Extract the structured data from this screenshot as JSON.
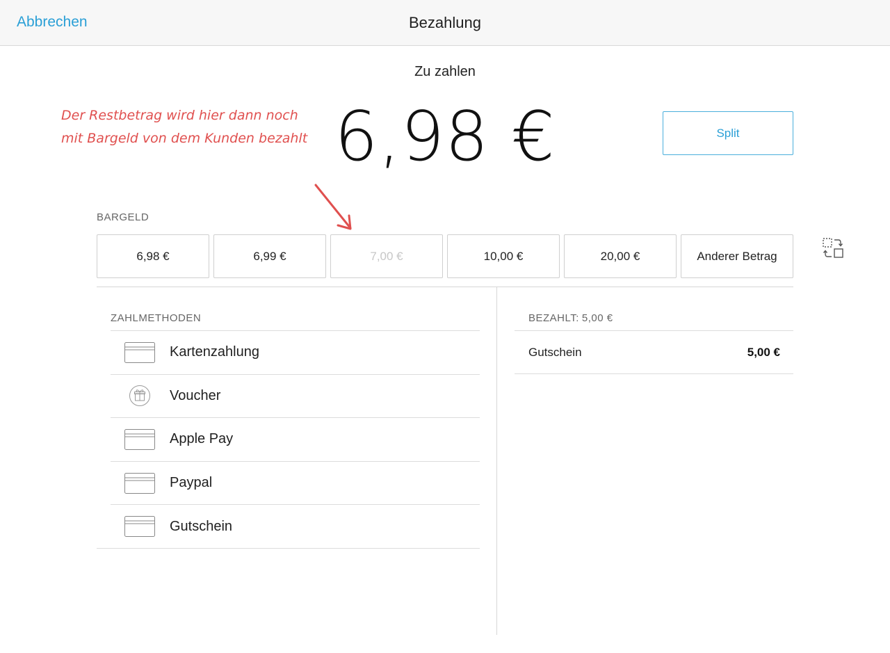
{
  "navbar": {
    "cancel_label": "Abbrechen",
    "title": "Bezahlung"
  },
  "due": {
    "label": "Zu zahlen",
    "amount": "6,98 €"
  },
  "annotation": {
    "line1": "Der Restbetrag wird hier dann noch",
    "line2": "mit Bargeld von dem Kunden bezahlt",
    "color": "#e0504f"
  },
  "split_label": "Split",
  "cash": {
    "label": "BARGELD",
    "options": [
      {
        "label": "6,98 €",
        "enabled": true
      },
      {
        "label": "6,99 €",
        "enabled": true
      },
      {
        "label": "7,00 €",
        "enabled": false
      },
      {
        "label": "10,00 €",
        "enabled": true
      },
      {
        "label": "20,00 €",
        "enabled": true
      },
      {
        "label": "Anderer Betrag",
        "enabled": true
      }
    ]
  },
  "methods": {
    "label": "ZAHLMETHODEN",
    "items": [
      {
        "label": "Kartenzahlung",
        "icon": "credit-card-icon"
      },
      {
        "label": "Voucher",
        "icon": "gift-icon"
      },
      {
        "label": "Apple Pay",
        "icon": "credit-card-icon"
      },
      {
        "label": "Paypal",
        "icon": "credit-card-icon"
      },
      {
        "label": "Gutschein",
        "icon": "credit-card-icon"
      }
    ]
  },
  "paid": {
    "label": "BEZAHLT:",
    "amount": "5,00 €",
    "rows": [
      {
        "name": "Gutschein",
        "value": "5,00 €"
      }
    ]
  },
  "colors": {
    "accent": "#2a9fd6",
    "divider": "#d6d6d6"
  }
}
